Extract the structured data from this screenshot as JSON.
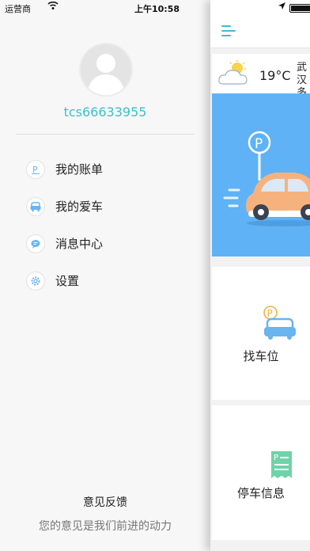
{
  "status_bar": {
    "carrier": "运营商",
    "time": "上午10:58"
  },
  "drawer": {
    "username": "tcs66633955",
    "menu": [
      {
        "label": "我的账单",
        "icon": "parking-bill-icon"
      },
      {
        "label": "我的爱车",
        "icon": "car-icon"
      },
      {
        "label": "消息中心",
        "icon": "message-icon"
      },
      {
        "label": "设置",
        "icon": "gear-icon"
      }
    ],
    "feedback_title": "意见反馈",
    "feedback_subtitle": "您的意见是我们前进的动力"
  },
  "main": {
    "weather": {
      "temperature": "19°C",
      "city_line1": "武汉",
      "city_line2": "多云",
      "icon": "partly-cloudy-icon"
    },
    "cards": {
      "find_spot_label": "找车位",
      "parking_info_label": "停车信息"
    }
  },
  "colors": {
    "accent": "#3cbfcb",
    "banner": "#5fb2f5",
    "car_body": "#f6b27d",
    "icon_blue": "#6ab4ef",
    "icon_green": "#6fd3a8"
  }
}
